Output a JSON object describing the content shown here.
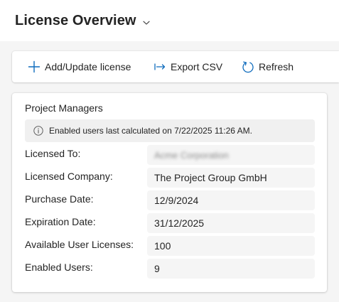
{
  "header": {
    "title": "License Overview"
  },
  "toolbar": {
    "add_label": "Add/Update license",
    "export_label": "Export CSV",
    "refresh_label": "Refresh"
  },
  "card": {
    "title": "Project Managers",
    "info_text": "Enabled users last calculated on 7/22/2025 11:26 AM.",
    "fields": [
      {
        "label": "Licensed To:",
        "value": "Acme Corporation",
        "redacted": true
      },
      {
        "label": "Licensed Company:",
        "value": "The Project Group GmbH"
      },
      {
        "label": "Purchase Date:",
        "value": "12/9/2024"
      },
      {
        "label": "Expiration Date:",
        "value": "31/12/2025"
      },
      {
        "label": "Available User Licenses:",
        "value": "100"
      },
      {
        "label": "Enabled Users:",
        "value": "9"
      }
    ]
  },
  "icons": {
    "title_dropdown": "chevron-down-icon",
    "add": "plus-icon",
    "export": "export-arrow-icon",
    "refresh": "refresh-icon",
    "info": "info-icon"
  },
  "colors": {
    "accent": "#0f6cbd",
    "text": "#242424",
    "field_bg": "#f5f5f5",
    "info_bg": "#f0f0f0"
  }
}
